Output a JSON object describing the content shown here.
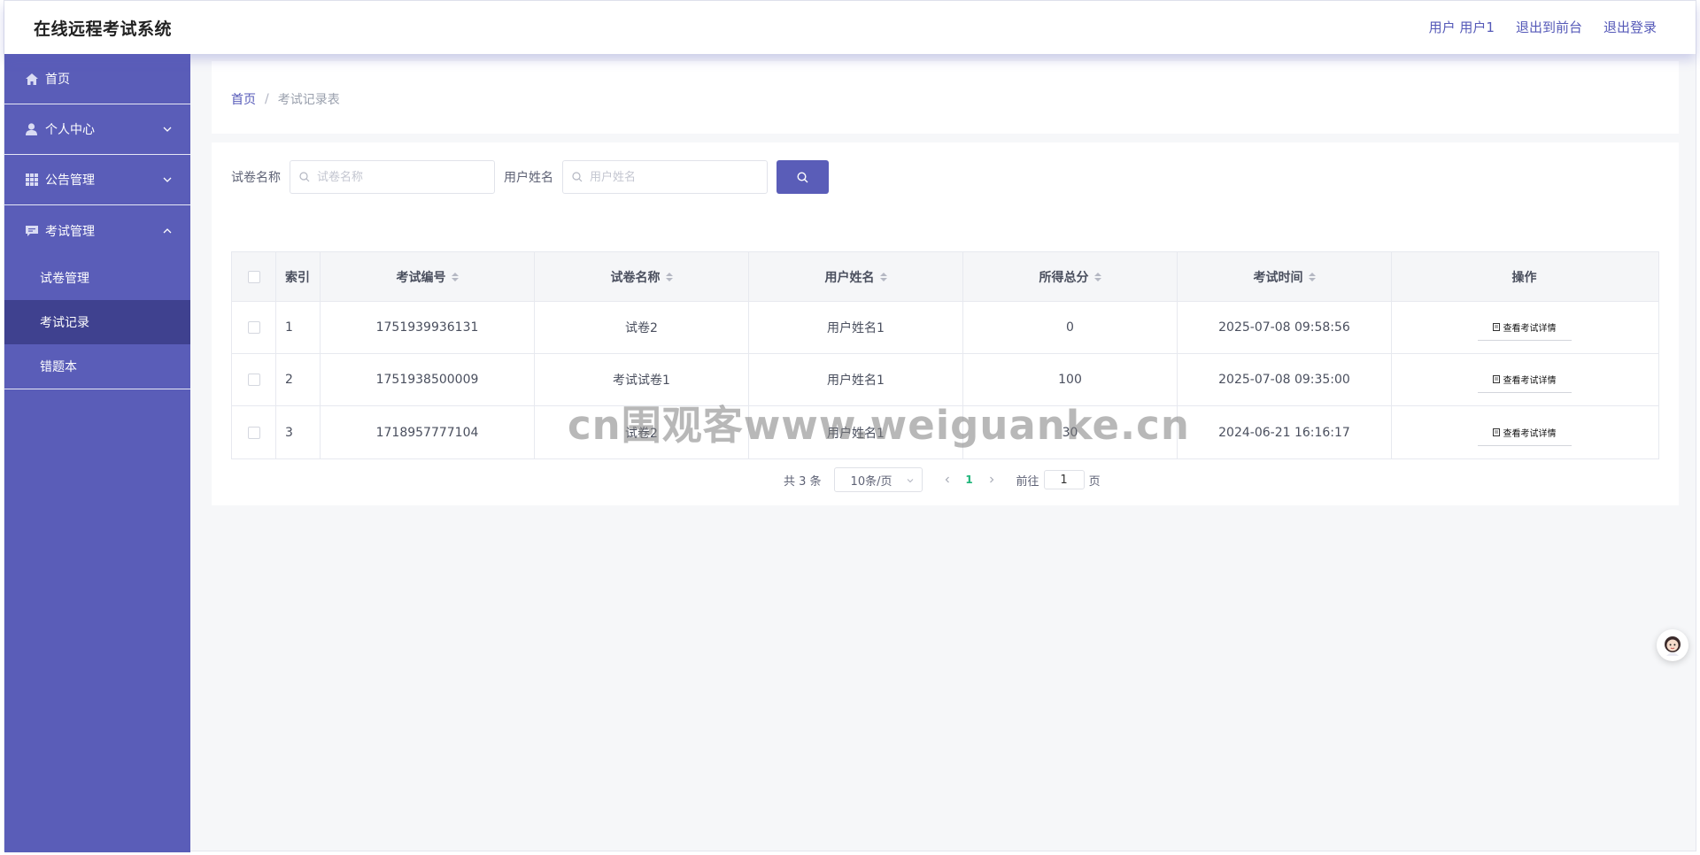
{
  "app": {
    "title": "在线远程考试系统"
  },
  "header": {
    "user": "用户 用户1",
    "back_to_front": "退出到前台",
    "logout": "退出登录"
  },
  "sidebar": {
    "items": [
      {
        "label": "首页",
        "icon": "home-icon"
      },
      {
        "label": "个人中心",
        "icon": "user-icon",
        "expanded": false
      },
      {
        "label": "公告管理",
        "icon": "grid-icon",
        "expanded": false
      },
      {
        "label": "考试管理",
        "icon": "message-icon",
        "expanded": true
      }
    ],
    "submenu": [
      {
        "label": "试卷管理"
      },
      {
        "label": "考试记录",
        "active": true
      },
      {
        "label": "错题本"
      }
    ]
  },
  "breadcrumb": {
    "home": "首页",
    "separator": "/",
    "current": "考试记录表"
  },
  "search": {
    "paper_label": "试卷名称",
    "paper_placeholder": "试卷名称",
    "user_label": "用户姓名",
    "user_placeholder": "用户姓名"
  },
  "table": {
    "headers": {
      "index": "索引",
      "exam_no": "考试编号",
      "paper_name": "试卷名称",
      "user_name": "用户姓名",
      "total_score": "所得总分",
      "exam_time": "考试时间",
      "operation": "操作"
    },
    "rows": [
      {
        "index": "1",
        "exam_no": "1751939936131",
        "paper_name": "试卷2",
        "user_name": "用户姓名1",
        "total_score": "0",
        "exam_time": "2025-07-08 09:58:56",
        "action": "查看考试详情"
      },
      {
        "index": "2",
        "exam_no": "1751938500009",
        "paper_name": "考试试卷1",
        "user_name": "用户姓名1",
        "total_score": "100",
        "exam_time": "2025-07-08 09:35:00",
        "action": "查看考试详情"
      },
      {
        "index": "3",
        "exam_no": "1718957777104",
        "paper_name": "试卷2",
        "user_name": "用户姓名1",
        "total_score": "30",
        "exam_time": "2024-06-21 16:16:17",
        "action": "查看考试详情"
      }
    ]
  },
  "pagination": {
    "total": "共 3 条",
    "page_size": "10条/页",
    "current_page": "1",
    "goto_prefix": "前往",
    "goto_value": "1",
    "goto_suffix": "页"
  },
  "watermark": "cn围观客www.weiguanke.cn",
  "colors": {
    "sidebar_bg": "#5a5db8",
    "sidebar_active": "#3f418f",
    "accent": "#5a5db8",
    "page_active": "#1fb57a"
  }
}
